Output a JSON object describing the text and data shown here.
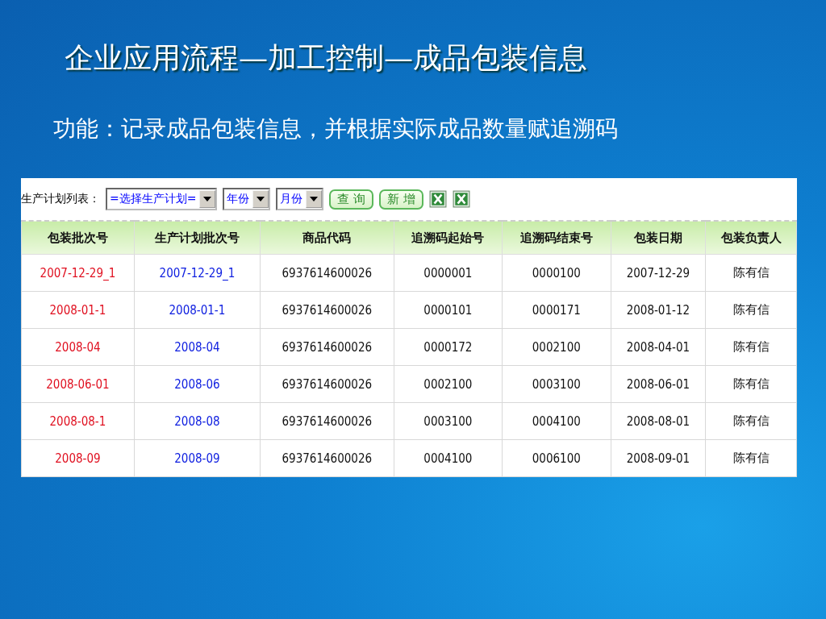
{
  "slide": {
    "title": "企业应用流程—加工控制—成品包装信息",
    "subtitle": "功能：记录成品包装信息，并根据实际成品数量赋追溯码"
  },
  "toolbar": {
    "label": "生产计划列表：",
    "selects": [
      "=选择生产计划=",
      "年份",
      "月份"
    ],
    "buttons": [
      "查 询",
      "新 增"
    ]
  },
  "table": {
    "columns": [
      "包装批次号",
      "生产计划批次号",
      "商品代码",
      "追溯码起始号",
      "追溯码结束号",
      "包装日期",
      "包装负责人"
    ],
    "rows": [
      [
        "2007-12-29_1",
        "2007-12-29_1",
        "6937614600026",
        "0000001",
        "0000100",
        "2007-12-29",
        "陈有信"
      ],
      [
        "2008-01-1",
        "2008-01-1",
        "6937614600026",
        "0000101",
        "0000171",
        "2008-01-12",
        "陈有信"
      ],
      [
        "2008-04",
        "2008-04",
        "6937614600026",
        "0000172",
        "0002100",
        "2008-04-01",
        "陈有信"
      ],
      [
        "2008-06-01",
        "2008-06",
        "6937614600026",
        "0002100",
        "0003100",
        "2008-06-01",
        "陈有信"
      ],
      [
        "2008-08-1",
        "2008-08",
        "6937614600026",
        "0003100",
        "0004100",
        "2008-08-01",
        "陈有信"
      ],
      [
        "2008-09",
        "2008-09",
        "6937614600026",
        "0004100",
        "0006100",
        "2008-09-01",
        "陈有信"
      ]
    ]
  }
}
